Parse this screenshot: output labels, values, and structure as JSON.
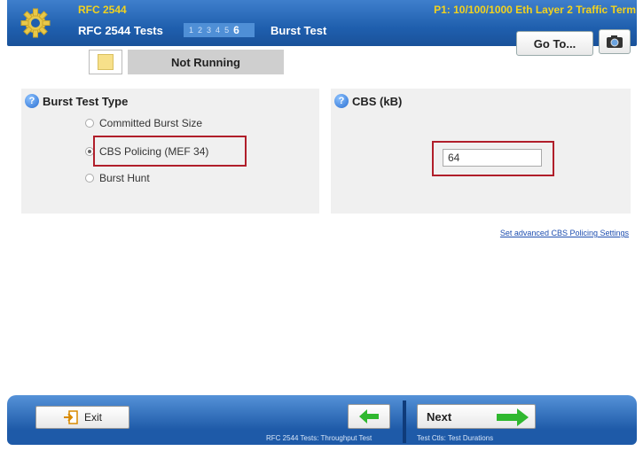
{
  "header": {
    "title": "RFC 2544",
    "port": "P1: 10/100/1000 Eth Layer 2 Traffic Term",
    "tests_label": "RFC 2544 Tests",
    "steps": [
      "1",
      "2",
      "3",
      "4",
      "5",
      "6"
    ],
    "current_step": "6",
    "page_label": "Burst Test",
    "goto_label": "Go To...",
    "icons": {
      "app": "gear-icon",
      "camera": "camera-icon"
    },
    "colors": {
      "bar": "#1f5fae",
      "title": "#f2d21e"
    }
  },
  "status": {
    "text": "Not Running",
    "icon": "status-indicator-icon"
  },
  "burst_type": {
    "title": "Burst Test Type",
    "options": [
      "Committed Burst Size",
      "CBS Policing (MEF 34)",
      "Burst Hunt"
    ],
    "selected": "CBS Policing (MEF 34)"
  },
  "cbs": {
    "title": "CBS (kB)",
    "value": "64"
  },
  "advanced_link": "Set advanced CBS Policing Settings",
  "footer": {
    "exit_label": "Exit",
    "next_label": "Next",
    "back_caption": "RFC 2544 Tests: Throughput Test",
    "next_caption": "Test Ctls: Test Durations",
    "colors": {
      "arrow": "#2fb82f",
      "highlight": "#b01e2a"
    }
  }
}
